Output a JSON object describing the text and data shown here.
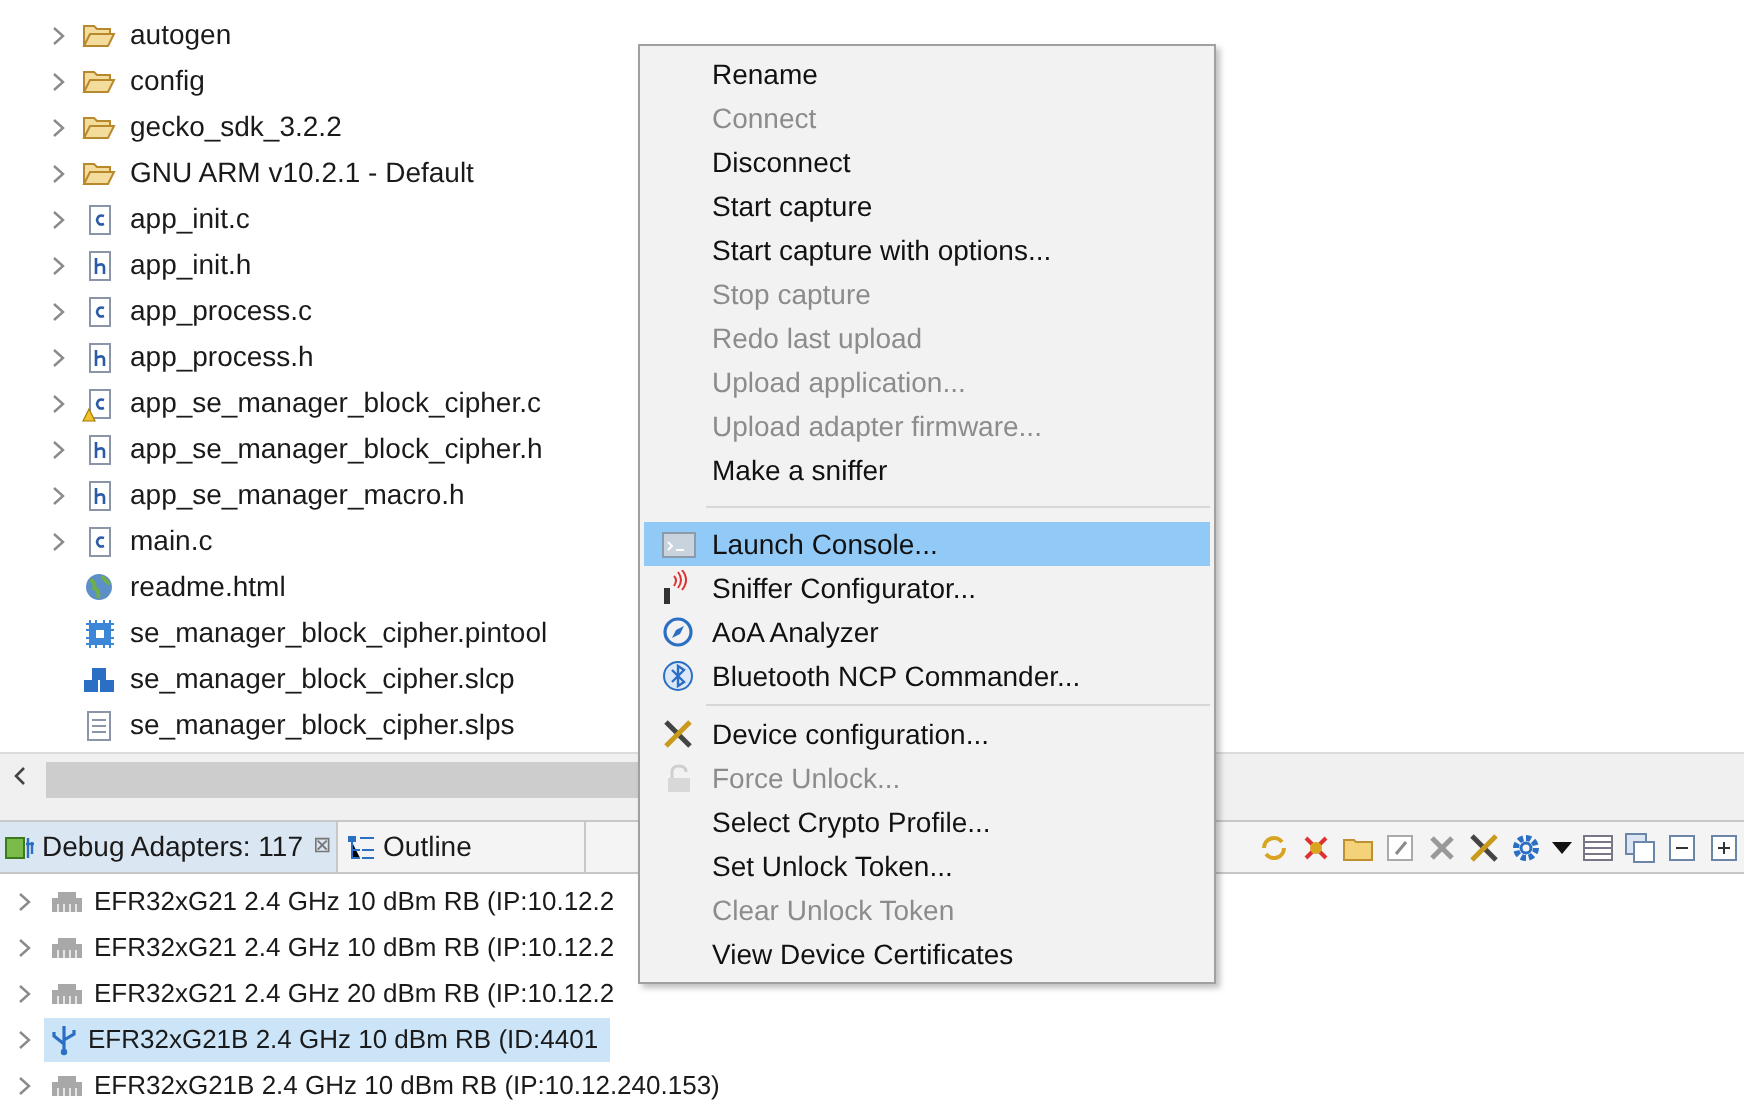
{
  "tree": [
    {
      "label": "autogen",
      "kind": "folder",
      "expandable": true,
      "warning": false
    },
    {
      "label": "config",
      "kind": "folder",
      "expandable": true,
      "warning": false
    },
    {
      "label": "gecko_sdk_3.2.2",
      "kind": "folder",
      "expandable": true,
      "warning": false
    },
    {
      "label": "GNU ARM v10.2.1 - Default",
      "kind": "folder",
      "expandable": true,
      "warning": false
    },
    {
      "label": "app_init.c",
      "kind": "c",
      "expandable": true,
      "warning": false
    },
    {
      "label": "app_init.h",
      "kind": "h",
      "expandable": true,
      "warning": false
    },
    {
      "label": "app_process.c",
      "kind": "c",
      "expandable": true,
      "warning": false
    },
    {
      "label": "app_process.h",
      "kind": "h",
      "expandable": true,
      "warning": false
    },
    {
      "label": "app_se_manager_block_cipher.c",
      "kind": "c",
      "expandable": true,
      "warning": true
    },
    {
      "label": "app_se_manager_block_cipher.h",
      "kind": "h",
      "expandable": true,
      "warning": false
    },
    {
      "label": "app_se_manager_macro.h",
      "kind": "h",
      "expandable": true,
      "warning": false
    },
    {
      "label": "main.c",
      "kind": "c",
      "expandable": true,
      "warning": false
    },
    {
      "label": "readme.html",
      "kind": "html",
      "expandable": false,
      "warning": false
    },
    {
      "label": "se_manager_block_cipher.pintool",
      "kind": "pintool",
      "expandable": false,
      "warning": false
    },
    {
      "label": "se_manager_block_cipher.slcp",
      "kind": "slcp",
      "expandable": false,
      "warning": false
    },
    {
      "label": "se_manager_block_cipher.slps",
      "kind": "slps",
      "expandable": false,
      "warning": false
    }
  ],
  "tabs": [
    {
      "label": "Debug Adapters: 117",
      "kind": "adapters",
      "selected": true,
      "close": "⊠"
    },
    {
      "label": "Outline",
      "kind": "outline",
      "selected": false
    }
  ],
  "devices": [
    {
      "label": "EFR32xG21 2.4 GHz 10 dBm RB (IP:10.12.2",
      "kind": "ethernet",
      "selected": false
    },
    {
      "label": "EFR32xG21 2.4 GHz 10 dBm RB (IP:10.12.2",
      "kind": "ethernet",
      "selected": false
    },
    {
      "label": "EFR32xG21 2.4 GHz 20 dBm RB (IP:10.12.2",
      "kind": "ethernet",
      "selected": false
    },
    {
      "label": "EFR32xG21B 2.4 GHz 10 dBm RB (ID:4401",
      "kind": "usb",
      "selected": true
    },
    {
      "label": "EFR32xG21B 2.4 GHz 10 dBm RB (IP:10.12.240.153)",
      "kind": "ethernet",
      "selected": false
    }
  ],
  "menu": [
    {
      "kind": "item",
      "label": "Rename",
      "disabled": false,
      "selected": false
    },
    {
      "kind": "item",
      "label": "Connect",
      "disabled": true,
      "selected": false
    },
    {
      "kind": "item",
      "label": "Disconnect",
      "disabled": false,
      "selected": false
    },
    {
      "kind": "item",
      "label": "Start capture",
      "disabled": false,
      "selected": false
    },
    {
      "kind": "item",
      "label": "Start capture with options...",
      "disabled": false,
      "selected": false
    },
    {
      "kind": "item",
      "label": "Stop capture",
      "disabled": true,
      "selected": false
    },
    {
      "kind": "item",
      "label": "Redo last upload",
      "disabled": true,
      "selected": false
    },
    {
      "kind": "item",
      "label": "Upload application...",
      "disabled": true,
      "selected": false
    },
    {
      "kind": "item",
      "label": "Upload adapter firmware...",
      "disabled": true,
      "selected": false
    },
    {
      "kind": "item",
      "label": "Make a sniffer",
      "disabled": false,
      "selected": false
    },
    {
      "kind": "separator"
    },
    {
      "kind": "item",
      "label": "Launch Console...",
      "disabled": false,
      "selected": true
    },
    {
      "kind": "item",
      "label": "Sniffer Configurator...",
      "disabled": false,
      "selected": false
    },
    {
      "kind": "item",
      "label": "AoA Analyzer",
      "disabled": false,
      "selected": false
    },
    {
      "kind": "item",
      "label": "Bluetooth NCP Commander...",
      "disabled": false,
      "selected": false
    },
    {
      "kind": "separator"
    },
    {
      "kind": "item",
      "label": "Device configuration...",
      "disabled": false,
      "selected": false
    },
    {
      "kind": "item",
      "label": "Force Unlock...",
      "disabled": true,
      "selected": false
    },
    {
      "kind": "item",
      "label": "Select Crypto Profile...",
      "disabled": false,
      "selected": false
    },
    {
      "kind": "item",
      "label": "Set Unlock Token...",
      "disabled": false,
      "selected": false
    },
    {
      "kind": "item",
      "label": "Clear Unlock Token",
      "disabled": true,
      "selected": false
    },
    {
      "kind": "item",
      "label": "View Device Certificates",
      "disabled": false,
      "selected": false
    }
  ]
}
